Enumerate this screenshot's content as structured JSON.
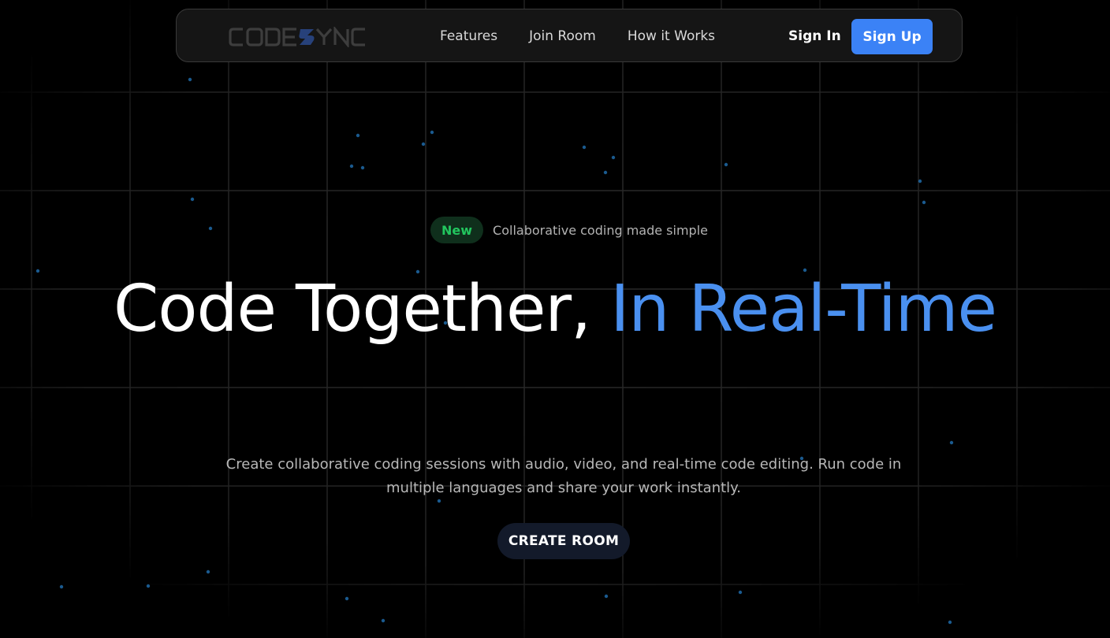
{
  "navbar": {
    "logo_text": "CODESYNC",
    "links": [
      {
        "label": "Features"
      },
      {
        "label": "Join Room"
      },
      {
        "label": "How it Works"
      }
    ],
    "sign_in": "Sign In",
    "sign_up": "Sign Up"
  },
  "hero": {
    "badge": "New",
    "badge_text": "Collaborative coding made simple",
    "headline_part1": "Code Together, ",
    "headline_part2": "In Real-Time",
    "subtitle": "Create collaborative coding sessions with audio, video, and real-time code editing. Run code in multiple languages and share your work instantly.",
    "cta": "CREATE ROOM"
  },
  "colors": {
    "background": "#000000",
    "accent_blue": "#3b82f6",
    "headline_blue": "#4a90f0",
    "badge_green": "#22c55e",
    "grid_line": "#2a2a2a",
    "particle": "#1e6aa8"
  }
}
